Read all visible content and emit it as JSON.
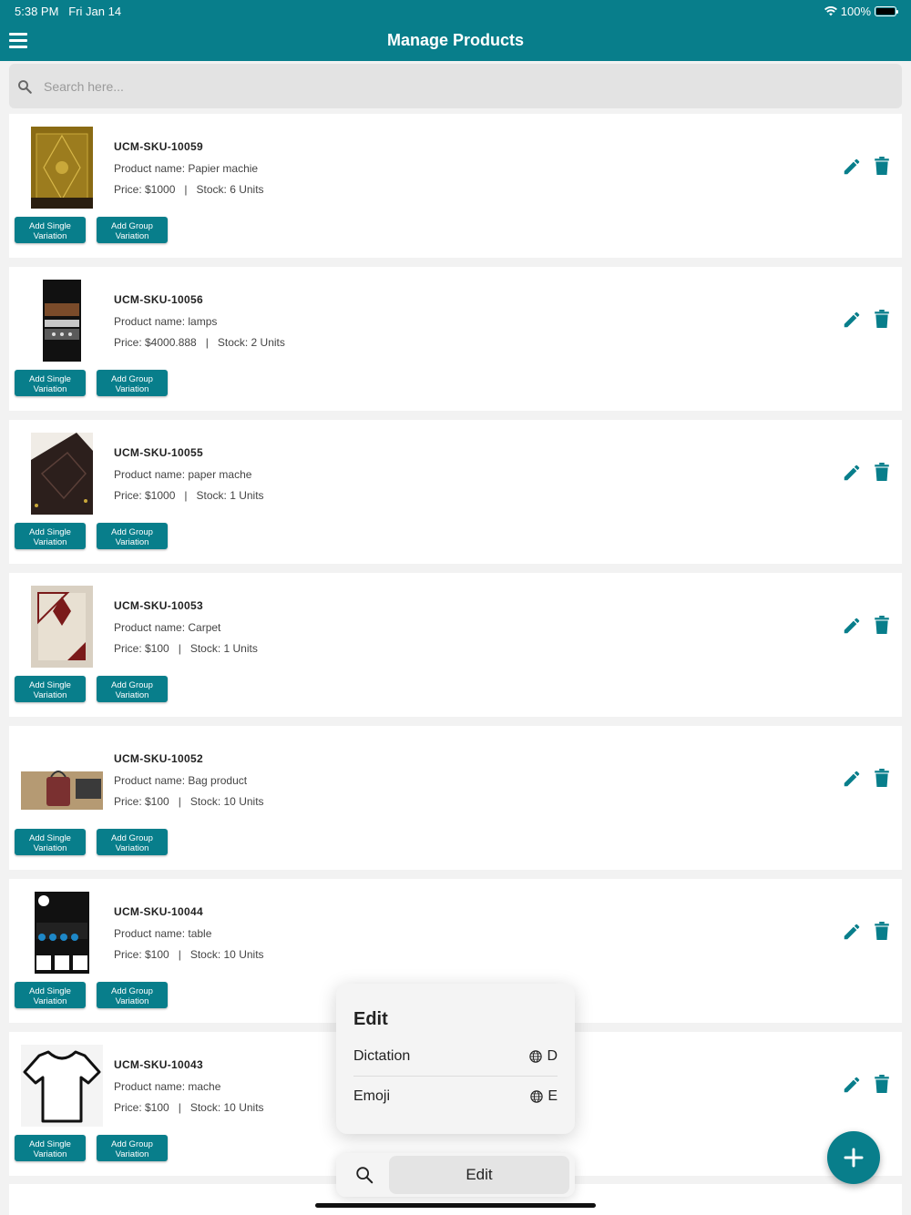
{
  "status": {
    "time": "5:38 PM",
    "date": "Fri Jan 14",
    "battery": "100%"
  },
  "header": {
    "title": "Manage Products"
  },
  "search": {
    "placeholder": "Search here..."
  },
  "buttons": {
    "add_single": "Add Single Variation",
    "add_group": "Add Group Variation"
  },
  "products": [
    {
      "sku": "UCM-SKU-10059",
      "name": "Product name: Papier machie",
      "price": "Price: $1000",
      "stock": "Stock: 6 Units"
    },
    {
      "sku": "UCM-SKU-10056",
      "name": "Product name: lamps",
      "price": "Price: $4000.888",
      "stock": "Stock: 2 Units"
    },
    {
      "sku": "UCM-SKU-10055",
      "name": "Product name: paper mache",
      "price": "Price: $1000",
      "stock": "Stock: 1 Units"
    },
    {
      "sku": "UCM-SKU-10053",
      "name": "Product name: Carpet",
      "price": "Price: $100",
      "stock": "Stock: 1 Units"
    },
    {
      "sku": "UCM-SKU-10052",
      "name": "Product name: Bag product",
      "price": "Price: $100",
      "stock": "Stock: 10 Units"
    },
    {
      "sku": "UCM-SKU-10044",
      "name": "Product name: table",
      "price": "Price: $100",
      "stock": "Stock: 10 Units"
    },
    {
      "sku": "UCM-SKU-10043",
      "name": "Product name: mache",
      "price": "Price: $100",
      "stock": "Stock: 10 Units"
    }
  ],
  "edit_menu": {
    "title": "Edit",
    "items": [
      {
        "label": "Dictation",
        "shortcut": "D"
      },
      {
        "label": "Emoji",
        "shortcut": "E"
      }
    ]
  },
  "bottom_bar": {
    "edit_label": "Edit"
  },
  "colors": {
    "primary": "#087e8b",
    "background": "#f2f2f2"
  }
}
